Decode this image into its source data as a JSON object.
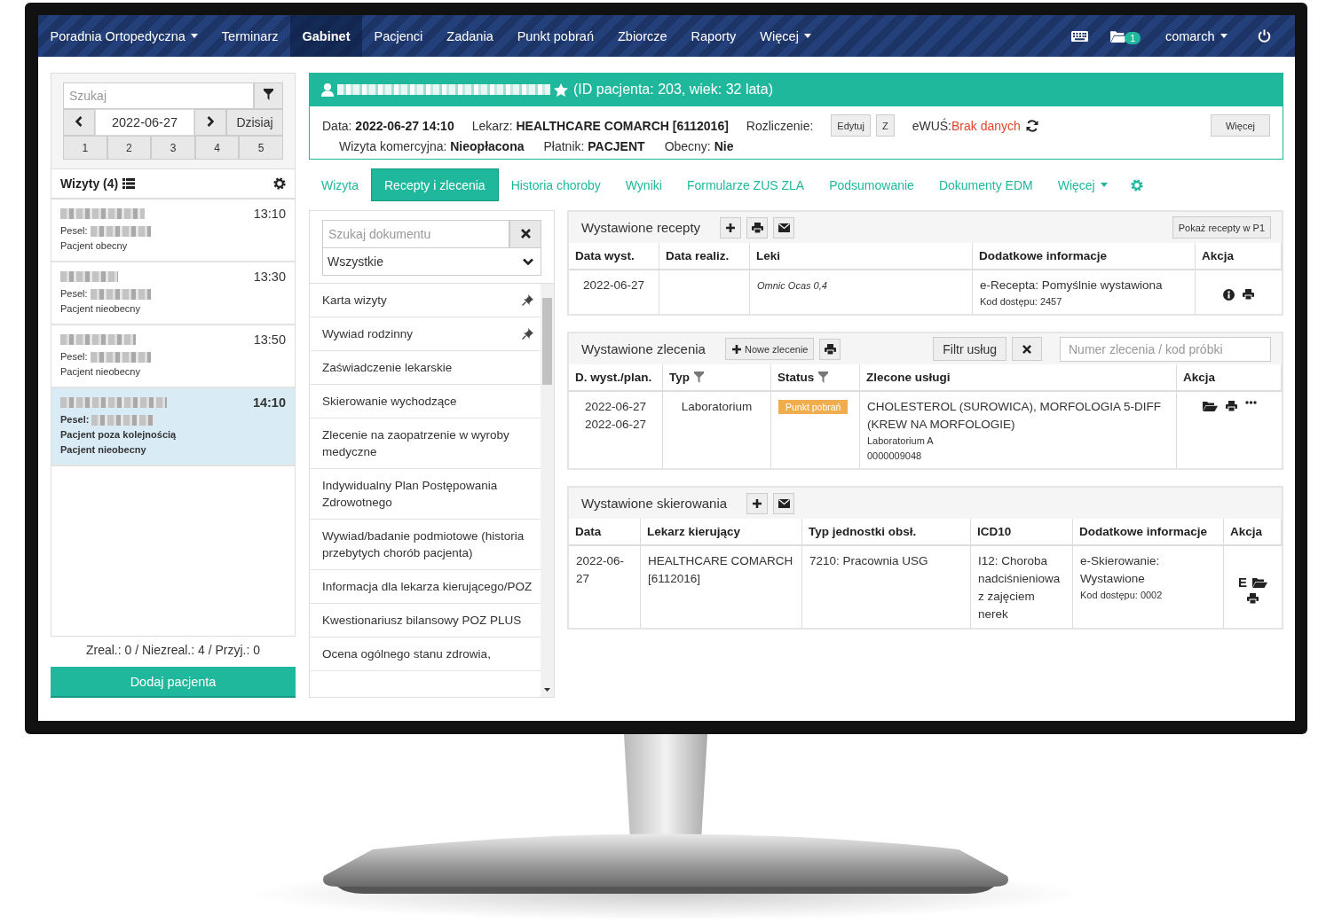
{
  "navbar": {
    "items": [
      {
        "label": "Poradnia Ortopedyczna",
        "dropdown": true,
        "selected": false
      },
      {
        "label": "Terminarz",
        "dropdown": false,
        "selected": false
      },
      {
        "label": "Gabinet",
        "dropdown": false,
        "selected": true
      },
      {
        "label": "Pacjenci",
        "dropdown": false,
        "selected": false
      },
      {
        "label": "Zadania",
        "dropdown": false,
        "selected": false
      },
      {
        "label": "Punkt pobrań",
        "dropdown": false,
        "selected": false
      },
      {
        "label": "Zbiorcze",
        "dropdown": false,
        "selected": false
      },
      {
        "label": "Raporty",
        "dropdown": false,
        "selected": false
      },
      {
        "label": "Więcej",
        "dropdown": true,
        "selected": false
      }
    ],
    "folder_badge": "1",
    "user": "comarch"
  },
  "sidebar": {
    "search": {
      "placeholder": "Szukaj"
    },
    "date": "2022-06-27",
    "today_button": "Dzisiaj",
    "day_buttons": [
      "1",
      "2",
      "3",
      "4",
      "5"
    ],
    "visits_title": "Wizyty (4)",
    "visits": [
      {
        "time": "13:10",
        "pesel_label": "Pesel:",
        "notes": [
          "Pacjent obecny"
        ],
        "selected": false
      },
      {
        "time": "13:30",
        "pesel_label": "Pesel:",
        "notes": [
          "Pacjent nieobecny"
        ],
        "selected": false
      },
      {
        "time": "13:50",
        "pesel_label": "Pesel:",
        "notes": [
          "Pacjent nieobecny"
        ],
        "selected": false
      },
      {
        "time": "14:10",
        "pesel_label": "Pesel:",
        "notes": [
          "Pacjent poza kolejnością",
          "Pacjent nieobecny"
        ],
        "selected": true
      }
    ],
    "summary": "Zreal.: 0 / Niezreal.: 4 / Przyj.: 0",
    "add_button": "Dodaj pacjenta"
  },
  "patient": {
    "info": "(ID pacjenta: 203, wiek: 32 lata)",
    "favorite": true,
    "row1": [
      {
        "label": "Data:",
        "value": "2022-06-27 14:10"
      },
      {
        "label": "Lekarz:",
        "value": "HEALTHCARE COMARCH [6112016]"
      }
    ],
    "billing_label": "Rozliczenie:",
    "billing_buttons": [
      "Edytuj",
      "Z"
    ],
    "ewus_label": "eWUŚ:",
    "ewus_value": "Brak danych",
    "more_button": "Więcej",
    "row2": [
      {
        "label": "Wizyta komercyjna:",
        "value": "Nieopłacona"
      },
      {
        "label": "Płatnik:",
        "value": "PACJENT"
      },
      {
        "label": "Obecny:",
        "value": "Nie"
      }
    ]
  },
  "tabs": [
    {
      "label": "Wizyta",
      "selected": false,
      "dropdown": false
    },
    {
      "label": "Recepty i zlecenia",
      "selected": true,
      "dropdown": false
    },
    {
      "label": "Historia choroby",
      "selected": false,
      "dropdown": false
    },
    {
      "label": "Wyniki",
      "selected": false,
      "dropdown": false
    },
    {
      "label": "Formularze ZUS ZLA",
      "selected": false,
      "dropdown": false
    },
    {
      "label": "Podsumowanie",
      "selected": false,
      "dropdown": false
    },
    {
      "label": "Dokumenty EDM",
      "selected": false,
      "dropdown": false
    },
    {
      "label": "Więcej",
      "selected": false,
      "dropdown": true
    }
  ],
  "documents": {
    "search": {
      "placeholder": "Szukaj dokumentu"
    },
    "filter": "Wszystkie",
    "items": [
      {
        "label": "Karta wizyty",
        "pinned": true
      },
      {
        "label": "Wywiad rodzinny",
        "pinned": true
      },
      {
        "label": "Zaświadczenie lekarskie",
        "pinned": false
      },
      {
        "label": "Skierowanie wychodzące",
        "pinned": false
      },
      {
        "label": "Zlecenie na zaopatrzenie w wyroby medyczne",
        "pinned": false
      },
      {
        "label": "Indywidualny Plan Postępowania Zdrowotnego",
        "pinned": false
      },
      {
        "label": "Wywiad/badanie podmiotowe (historia przebytych chorób pacjenta)",
        "pinned": false
      },
      {
        "label": "Informacja dla lekarza kierującego/POZ",
        "pinned": false
      },
      {
        "label": "Kwestionariusz bilansowy POZ PLUS",
        "pinned": false
      },
      {
        "label": "Ocena ogólnego stanu zdrowia,",
        "pinned": false
      }
    ]
  },
  "prescriptions": {
    "title": "Wystawione recepty",
    "p1_button": "Pokaż recepty w P1",
    "columns": [
      "Data wyst.",
      "Data realiz.",
      "Leki",
      "Dodatkowe informacje",
      "Akcja"
    ],
    "rows": [
      {
        "date": "2022-06-27",
        "drug": "Omnic Ocas 0,4",
        "info": "e-Recepta: Pomyślnie wystawiona",
        "access": "Kod dostępu: 2457"
      }
    ]
  },
  "orders": {
    "title": "Wystawione zlecenia",
    "new_button": "Nowe zlecenie",
    "filter_button": "Filtr usług",
    "search": {
      "placeholder": "Numer zlecenia / kod próbki"
    },
    "columns": [
      {
        "label": "D. wyst./plan.",
        "filter": false
      },
      {
        "label": "Typ",
        "filter": true
      },
      {
        "label": "Status",
        "filter": true
      },
      {
        "label": "Zlecone usługi",
        "filter": false
      },
      {
        "label": "Akcja",
        "filter": false
      }
    ],
    "rows": [
      {
        "dates": [
          "2022-06-27",
          "2022-06-27"
        ],
        "type": "Laboratorium",
        "status": "Punkt pobrań",
        "services": "CHOLESTEROL (SUROWICA), MORFOLOGIA 5-DIFF (KREW NA MORFOLOGIE)",
        "lab": "Laboratorium A",
        "code": "0000009048"
      }
    ]
  },
  "referrals": {
    "title": "Wystawione skierowania",
    "columns": [
      "Data",
      "Lekarz kierujący",
      "Typ jednostki obsł.",
      "ICD10",
      "Dodatkowe informacje",
      "Akcja"
    ],
    "rows": [
      {
        "date": "2022-06-27",
        "doctor": "HEALTHCARE COMARCH [6112016]",
        "unit": "7210: Pracownia USG",
        "icd": "I12: Choroba nadciśnieniowa z zajęciem nerek",
        "info": "e-Skierowanie: Wystawione",
        "access": "Kod dostępu: 0002",
        "action_letter": "E"
      }
    ]
  }
}
